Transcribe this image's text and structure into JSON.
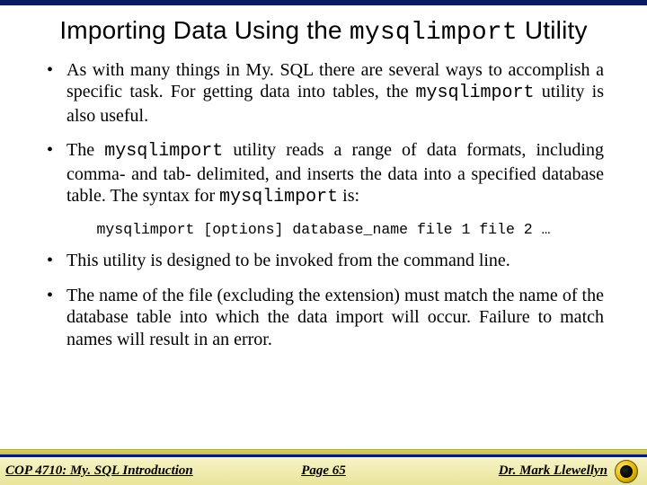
{
  "title": {
    "pre": "Importing Data Using the ",
    "mono": "mysqlimport",
    "post": "  Utility"
  },
  "bullets": {
    "b1": {
      "pre": "As with many things in My. SQL there are several ways to accomplish a specific task.  For getting data into tables, the ",
      "mono": "mysqlimport",
      "post": " utility is also useful."
    },
    "b2": {
      "pre": "The ",
      "mono1": "mysqlimport",
      "mid": " utility reads a range of data formats, including comma- and tab- delimited, and inserts the data into a specified database table.  The syntax for ",
      "mono2": "mysqlimport",
      "post": " is:"
    },
    "syntax": "mysqlimport [options] database_name file 1 file 2 …",
    "b3": "This utility is designed to be invoked from the command line.",
    "b4": "The name of the file (excluding the extension) must match the name of the database table into which the data import will occur.  Failure to match names will result in an error."
  },
  "footer": {
    "left": "COP 4710: My. SQL Introduction",
    "center": "Page 65",
    "right": "Dr. Mark Llewellyn"
  }
}
